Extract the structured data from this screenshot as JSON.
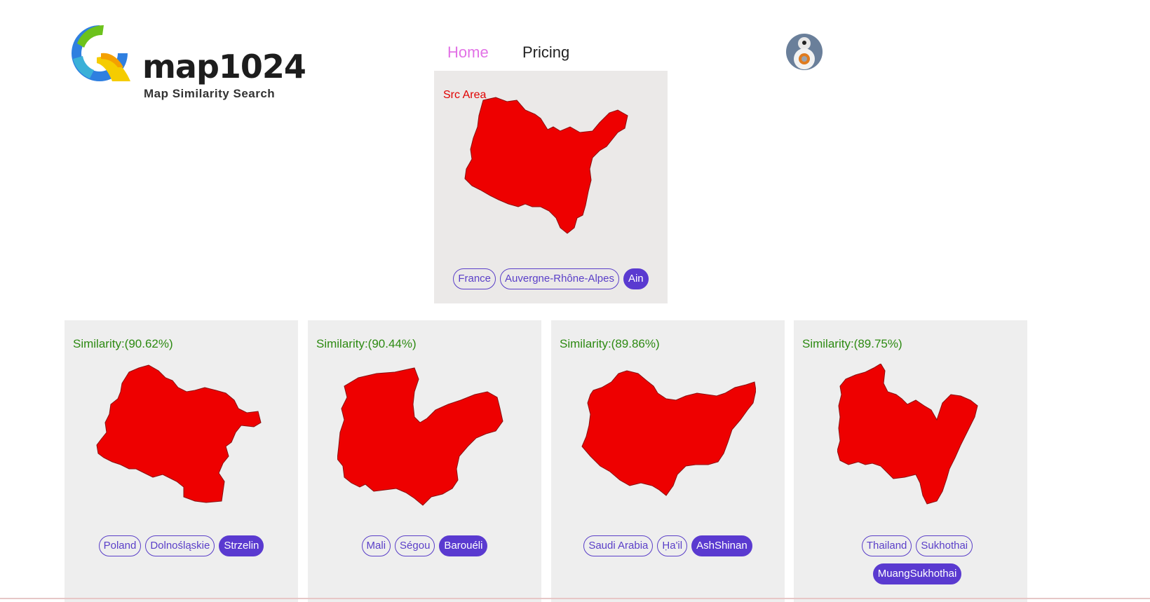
{
  "brand": {
    "name": "map1024",
    "tagline": "Map Similarity Search"
  },
  "nav": {
    "home": "Home",
    "pricing": "Pricing"
  },
  "colors": {
    "accent": "#5a3ad0",
    "nav_active": "#e272e6",
    "similarity": "#2d8a12",
    "shape_fill": "#ee0000"
  },
  "source": {
    "label": "Src Area",
    "tags": {
      "country": "France",
      "region": "Auvergne-Rhône-Alpes",
      "area": "Ain"
    }
  },
  "results": [
    {
      "similarity": "Similarity:(90.62%)",
      "country": "Poland",
      "region": "Dolnośląskie",
      "area": "Strzelin"
    },
    {
      "similarity": "Similarity:(90.44%)",
      "country": "Mali",
      "region": "Ségou",
      "area": "Barouéli"
    },
    {
      "similarity": "Similarity:(89.86%)",
      "country": "Saudi Arabia",
      "region": "Ḥa'il",
      "area": "AshShinan"
    },
    {
      "similarity": "Similarity:(89.75%)",
      "country": "Thailand",
      "region": "Sukhothai",
      "area": "MuangSukhothai"
    }
  ]
}
